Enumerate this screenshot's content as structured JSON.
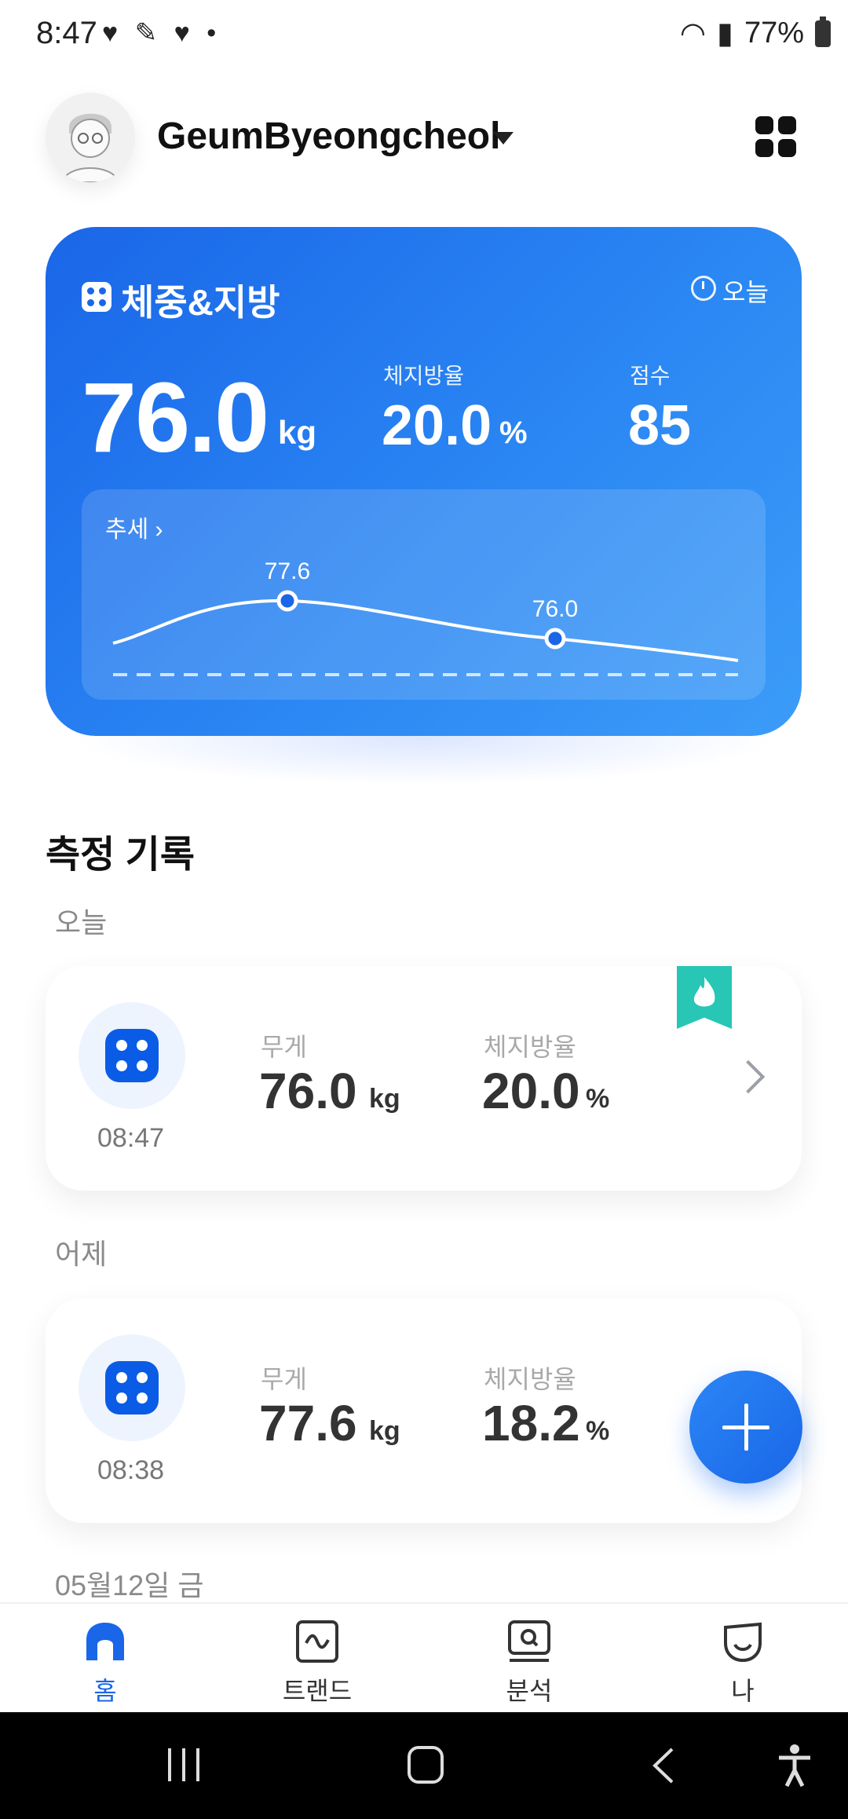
{
  "status_bar": {
    "time": "8:47",
    "battery": "77%"
  },
  "header": {
    "username": "GeumByeongcheol",
    "icons": [
      "avatar",
      "chevron-down-icon",
      "apps-grid-icon"
    ]
  },
  "summary_card": {
    "title": "체중&지방",
    "period": "오늘",
    "weight": "76.0",
    "weight_unit": "kg",
    "body_fat_label": "체지방율",
    "body_fat": "20.0",
    "body_fat_unit": "%",
    "score_label": "점수",
    "score": "85",
    "trend_label": "추세",
    "trend_points": [
      "77.6",
      "76.0"
    ],
    "colors": {
      "card_start": "#1a66e8",
      "card_end": "#3c9cf8"
    }
  },
  "records": {
    "title": "측정 기록",
    "groups": [
      {
        "day": "오늘",
        "time": "08:47",
        "weight_label": "무게",
        "weight": "76.0",
        "weight_unit": "kg",
        "fat_label": "체지방율",
        "fat": "20.0",
        "fat_unit": "%",
        "badge": "flame-bookmark-icon"
      },
      {
        "day": "어제",
        "time": "08:38",
        "weight_label": "무게",
        "weight": "77.6",
        "weight_unit": "kg",
        "fat_label": "체지방율",
        "fat": "18.2",
        "fat_unit": "%"
      }
    ],
    "next_day": "05월12일 금"
  },
  "bottom_nav": {
    "items": [
      {
        "label": "홈",
        "icon": "home-icon",
        "active": true
      },
      {
        "label": "트랜드",
        "icon": "trend-icon",
        "active": false
      },
      {
        "label": "분석",
        "icon": "analysis-icon",
        "active": false
      },
      {
        "label": "나",
        "icon": "profile-icon",
        "active": false
      }
    ]
  },
  "accent_color": "#1a66e8"
}
